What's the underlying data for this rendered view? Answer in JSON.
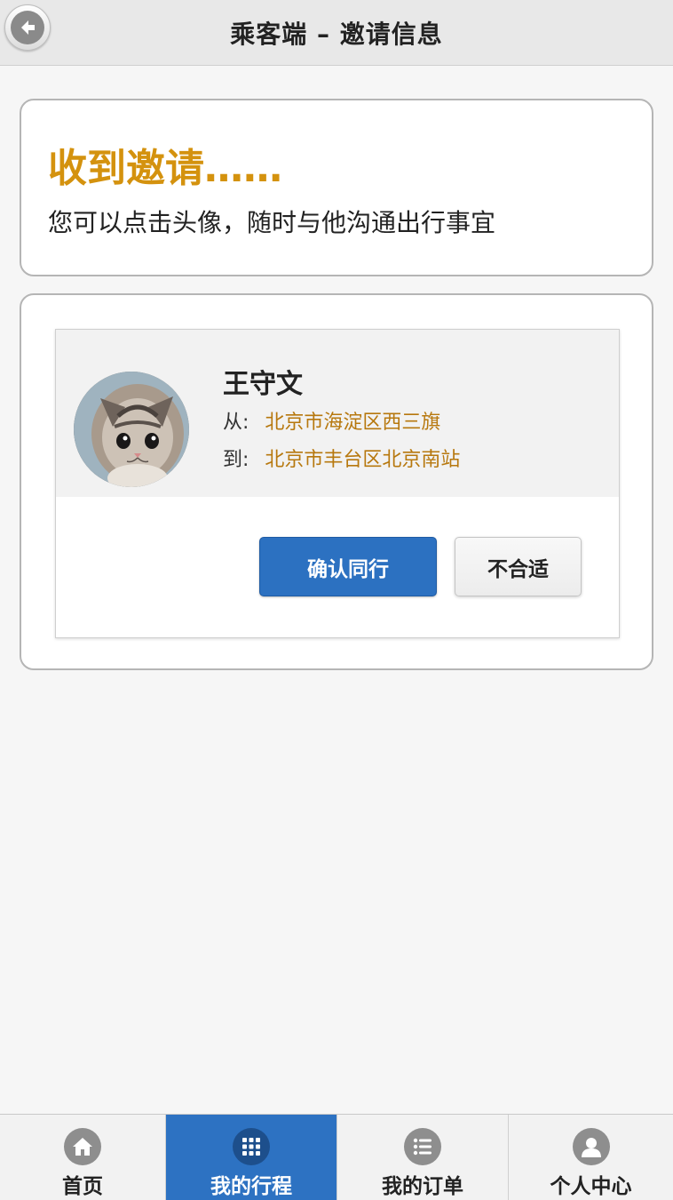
{
  "header": {
    "title": "乘客端 – 邀请信息"
  },
  "notice": {
    "title": "收到邀请……",
    "text": "您可以点击头像，随时与他沟通出行事宜"
  },
  "invite": {
    "name": "王守文",
    "from_label": "从:",
    "from_value": "北京市海淀区西三旗",
    "to_label": "到:",
    "to_value": "北京市丰台区北京南站",
    "confirm_label": "确认同行",
    "decline_label": "不合适"
  },
  "nav": {
    "items": [
      {
        "label": "首页",
        "icon": "home-icon"
      },
      {
        "label": "我的行程",
        "icon": "grid-icon",
        "active": true
      },
      {
        "label": "我的订单",
        "icon": "list-icon"
      },
      {
        "label": "个人中心",
        "icon": "user-icon"
      }
    ]
  },
  "colors": {
    "accent": "#2c71c1",
    "notice_title": "#d4920e",
    "route_value": "#b7780e"
  }
}
